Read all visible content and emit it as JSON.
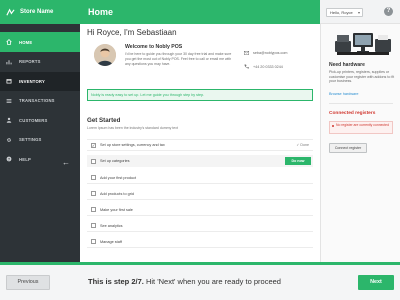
{
  "app": {
    "brand": "Store Name",
    "accent": "#2cb66b"
  },
  "sidebar": {
    "items": [
      {
        "label": "HOME",
        "icon": "home-icon"
      },
      {
        "label": "REPORTS",
        "icon": "bar-chart-icon"
      },
      {
        "label": "INVENTORY",
        "icon": "box-icon"
      },
      {
        "label": "TRANSACTIONS",
        "icon": "list-icon"
      },
      {
        "label": "CUSTOMERS",
        "icon": "user-icon"
      },
      {
        "label": "SETTINGS",
        "icon": "gear-icon"
      },
      {
        "label": "HELP",
        "icon": "help-icon"
      }
    ],
    "collapse_glyph": "←"
  },
  "header": {
    "title": "Home",
    "user_label": "Hello, Royce",
    "help_glyph": "?"
  },
  "welcome": {
    "greeting": "Hi Royce, I'm Sebastiaan",
    "title": "Welcome to Nobly POS",
    "text": "I'd be here to guide you through your 30 day free trial and make sure you get the most out of Nobly POS. Feel free to call or email me with any questions you may have.",
    "email": "seba@noblypos.com",
    "phone": "+44 20 0333 0244"
  },
  "banner": {
    "text": "Nobly is ready easy to set up. Let me guide you through step by step."
  },
  "getting_started": {
    "title": "Get Started",
    "subtitle": "Lorem Ipsum has been the industry's standard dummy text",
    "tasks": [
      {
        "label": "Set up store settings, currency and tax",
        "state": "done",
        "tag": "✓ Done"
      },
      {
        "label": "Set up categories",
        "state": "current",
        "action": "Do now"
      },
      {
        "label": "Add your first product",
        "state": "todo"
      },
      {
        "label": "Add products to grid",
        "state": "todo"
      },
      {
        "label": "Make your first sale",
        "state": "todo"
      },
      {
        "label": "See analytics",
        "state": "todo"
      },
      {
        "label": "Manage staff",
        "state": "todo"
      }
    ]
  },
  "hardware": {
    "title": "Need hardware",
    "text": "Pick-up printers, registers, supplies or customise your register with addons to fit your business.",
    "link": "Browse hardware"
  },
  "registers": {
    "title": "Connected registers",
    "warning": "No register are currently connected",
    "button": "Connect register"
  },
  "footer": {
    "previous": "Previous",
    "step_bold": "This is step 2/7.",
    "step_rest": " Hit 'Next' when you are ready to proceed",
    "next": "Next",
    "progress": 0.2857
  }
}
